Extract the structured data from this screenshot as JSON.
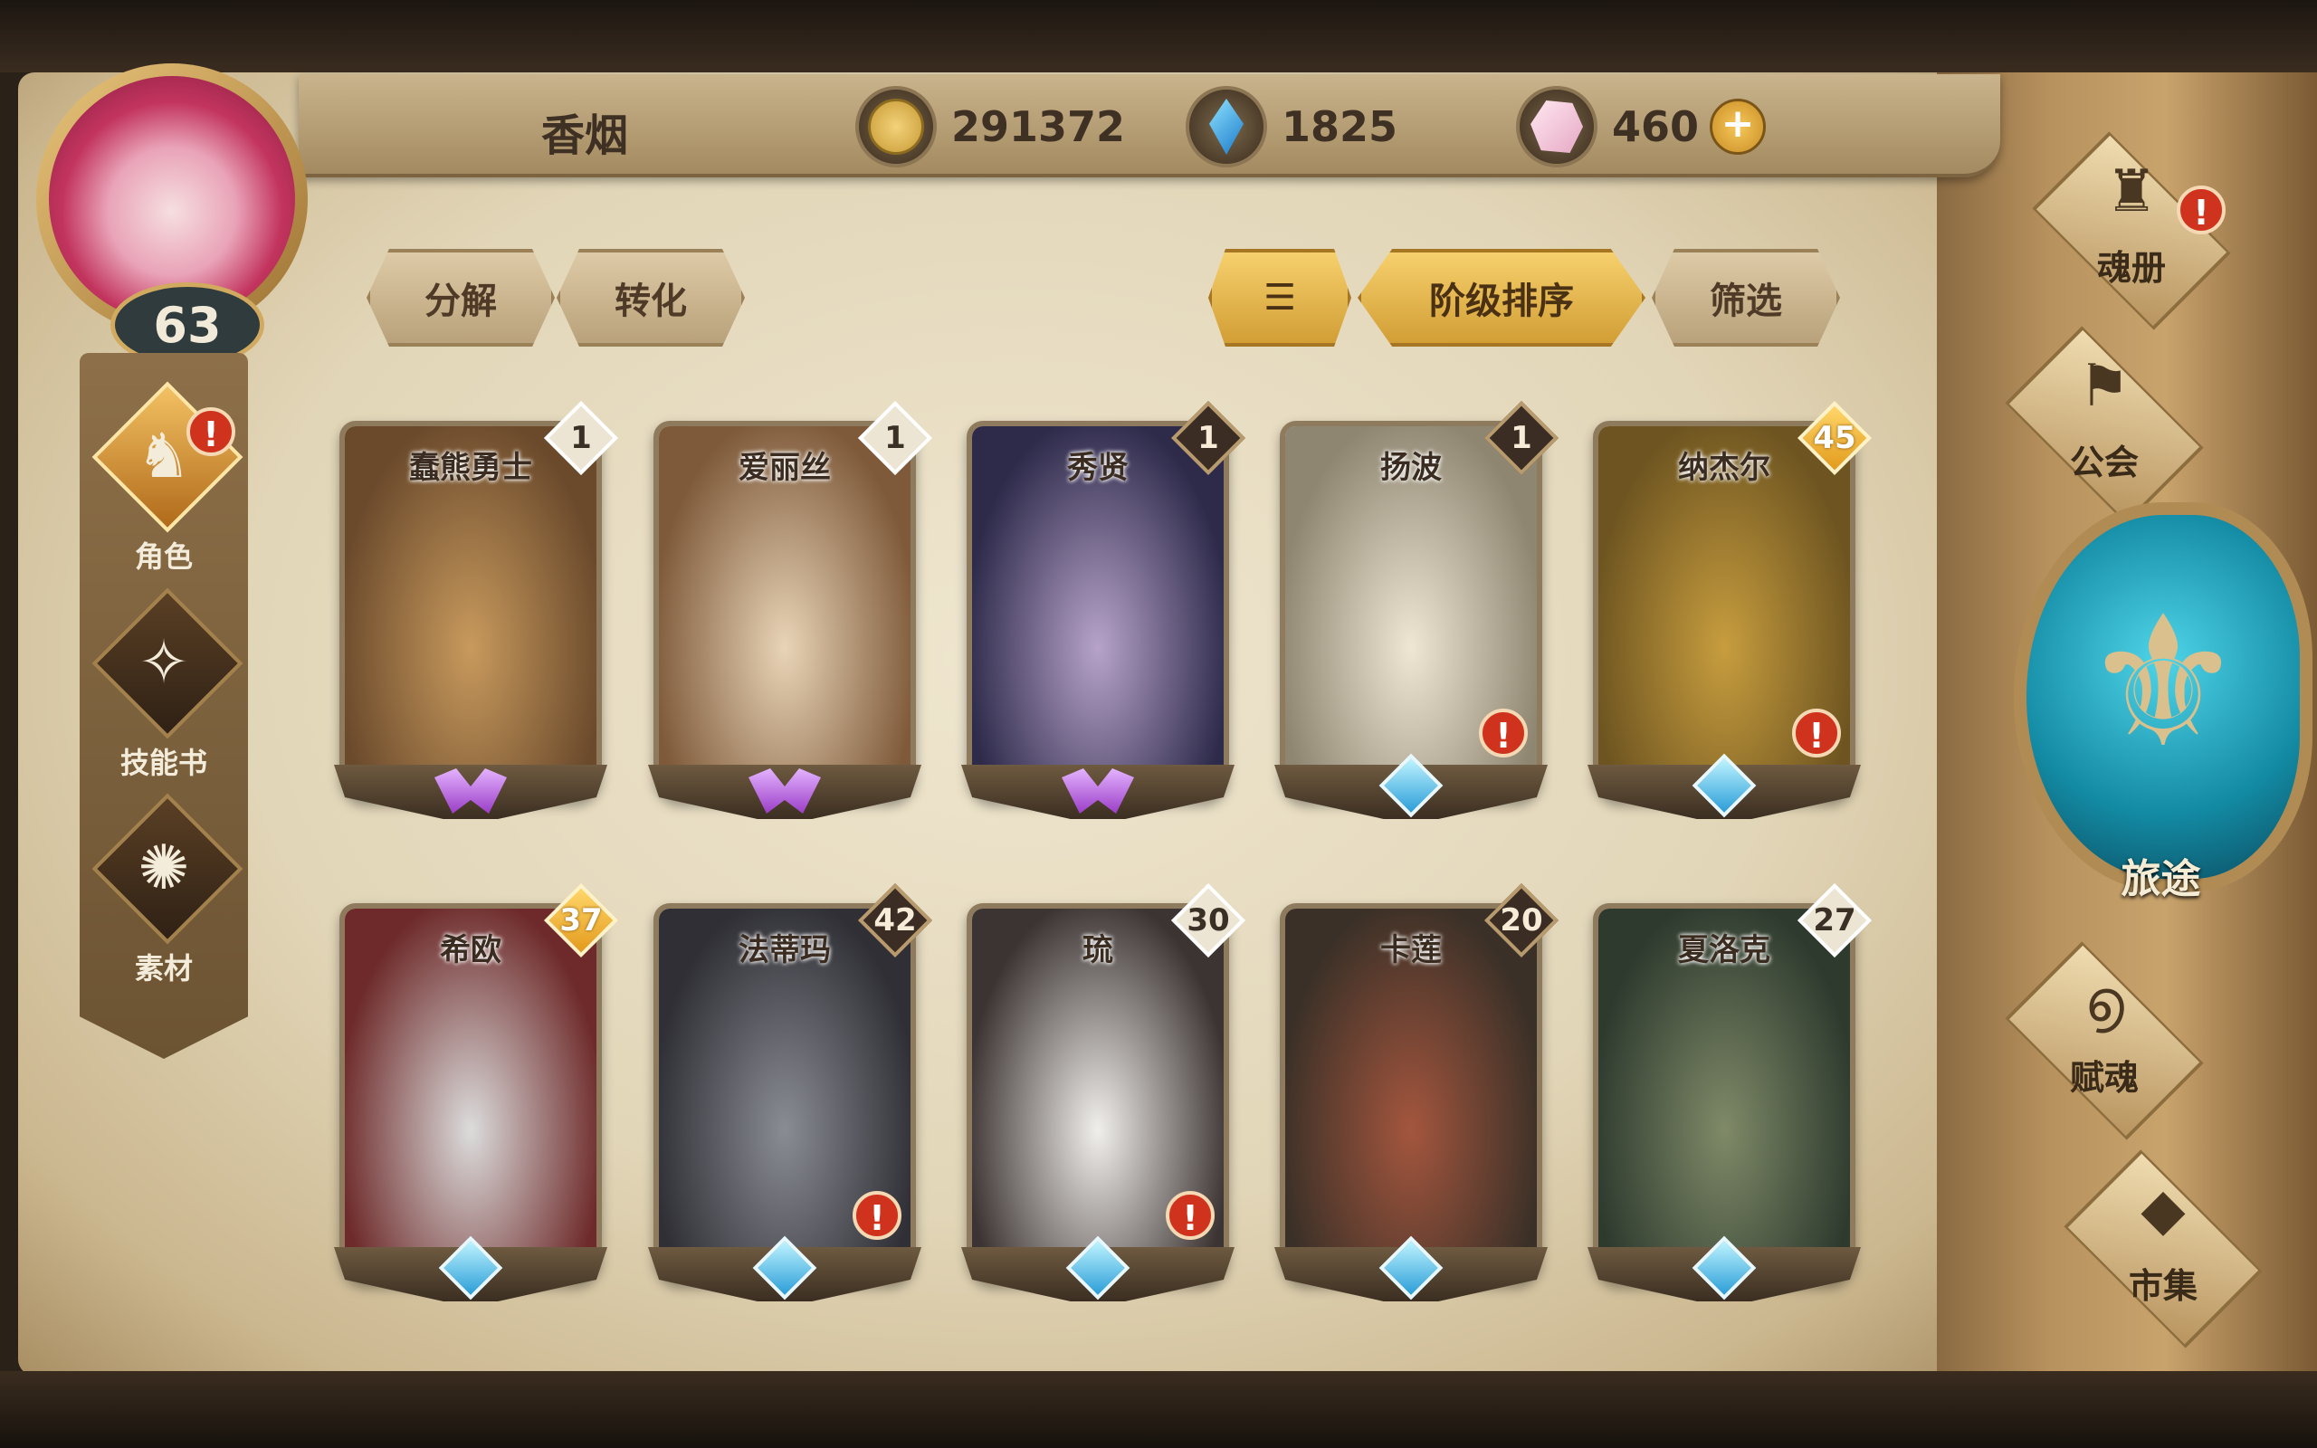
{
  "player": {
    "name": "香烟",
    "level": "63"
  },
  "resources": [
    {
      "icon": "gold-coin-icon",
      "value": "291372"
    },
    {
      "icon": "blue-gem-icon",
      "value": "1825"
    },
    {
      "icon": "crystal-icon",
      "value": "460"
    }
  ],
  "left_nav": [
    {
      "label": "角色",
      "icon": "character-icon",
      "alert": true,
      "active": true
    },
    {
      "label": "技能书",
      "icon": "skill-book-icon",
      "alert": false,
      "active": false
    },
    {
      "label": "素材",
      "icon": "material-icon",
      "alert": false,
      "active": false
    }
  ],
  "toolbar": {
    "decompose": "分解",
    "convert": "转化",
    "sort_icon": "sort-icon",
    "sort_by_rank": "阶级排序",
    "filter": "筛选"
  },
  "cards": [
    {
      "name": "蠢熊勇士",
      "level": "1",
      "level_style": "white",
      "gem": "purple",
      "alert": false,
      "colors": [
        "#6b4a2c",
        "#c89a5d"
      ]
    },
    {
      "name": "爱丽丝",
      "level": "1",
      "level_style": "white",
      "gem": "purple",
      "alert": false,
      "colors": [
        "#7e5a3a",
        "#e9d4b7"
      ]
    },
    {
      "name": "秀贤",
      "level": "1",
      "level_style": "dark",
      "gem": "purple",
      "alert": false,
      "colors": [
        "#2d2a4a",
        "#b7a3c9"
      ]
    },
    {
      "name": "扬波",
      "level": "1",
      "level_style": "dark",
      "gem": "blue",
      "alert": true,
      "colors": [
        "#8f8672",
        "#efe6d3"
      ]
    },
    {
      "name": "纳杰尔",
      "level": "45",
      "level_style": "gold",
      "gem": "blue",
      "alert": true,
      "colors": [
        "#6d5420",
        "#c79d3e"
      ]
    },
    {
      "name": "希欧",
      "level": "37",
      "level_style": "gold",
      "gem": "blue",
      "alert": false,
      "colors": [
        "#6e2a2a",
        "#dcdcdc"
      ]
    },
    {
      "name": "法蒂玛",
      "level": "42",
      "level_style": "dark",
      "gem": "blue",
      "alert": true,
      "colors": [
        "#2f2f35",
        "#8a8c94"
      ]
    },
    {
      "name": "琉",
      "level": "30",
      "level_style": "white",
      "gem": "blue",
      "alert": true,
      "colors": [
        "#3c3432",
        "#f1efec"
      ]
    },
    {
      "name": "卡莲",
      "level": "20",
      "level_style": "dark",
      "gem": "blue",
      "alert": false,
      "colors": [
        "#3a3027",
        "#a4563e"
      ]
    },
    {
      "name": "夏洛克",
      "level": "27",
      "level_style": "white",
      "gem": "blue",
      "alert": false,
      "colors": [
        "#2e3a2e",
        "#7f8a68"
      ]
    }
  ],
  "right_menu": [
    {
      "label": "魂册",
      "icon": "soul-book-icon",
      "alert": true
    },
    {
      "label": "公会",
      "icon": "guild-icon",
      "alert": false
    },
    {
      "label": "旅途",
      "icon": "journey-emblem-icon",
      "alert": false
    },
    {
      "label": "赋魂",
      "icon": "soul-infuse-icon",
      "alert": false
    },
    {
      "label": "市集",
      "icon": "market-icon",
      "alert": false
    }
  ]
}
